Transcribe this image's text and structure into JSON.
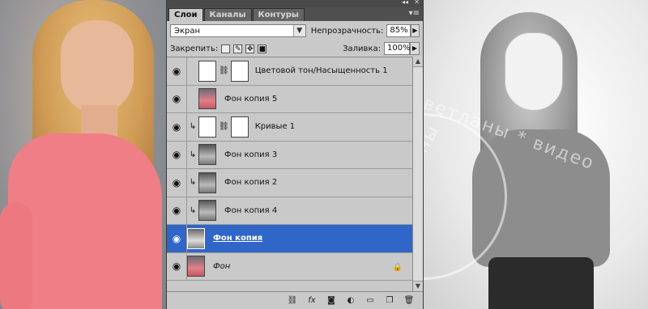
{
  "tabs": [
    "Слои",
    "Каналы",
    "Контуры"
  ],
  "blend": {
    "mode": "Экран",
    "opacity_label": "Непрозрачность:",
    "opacity_value": "85%"
  },
  "lock": {
    "label": "Закрепить:",
    "fill_label": "Заливка:",
    "fill_value": "100%"
  },
  "layers": [
    {
      "name": "Цветовой тон/Насыщенность 1"
    },
    {
      "name": "Фон копия 5"
    },
    {
      "name": "Кривые 1"
    },
    {
      "name": "Фон копия 3"
    },
    {
      "name": "Фон копия 2"
    },
    {
      "name": "Фон копия 4"
    },
    {
      "name": "Фон копия"
    },
    {
      "name": "Фон"
    }
  ],
  "watermark": {
    "text": "Светланы * видео",
    "text2": "Светланы"
  }
}
